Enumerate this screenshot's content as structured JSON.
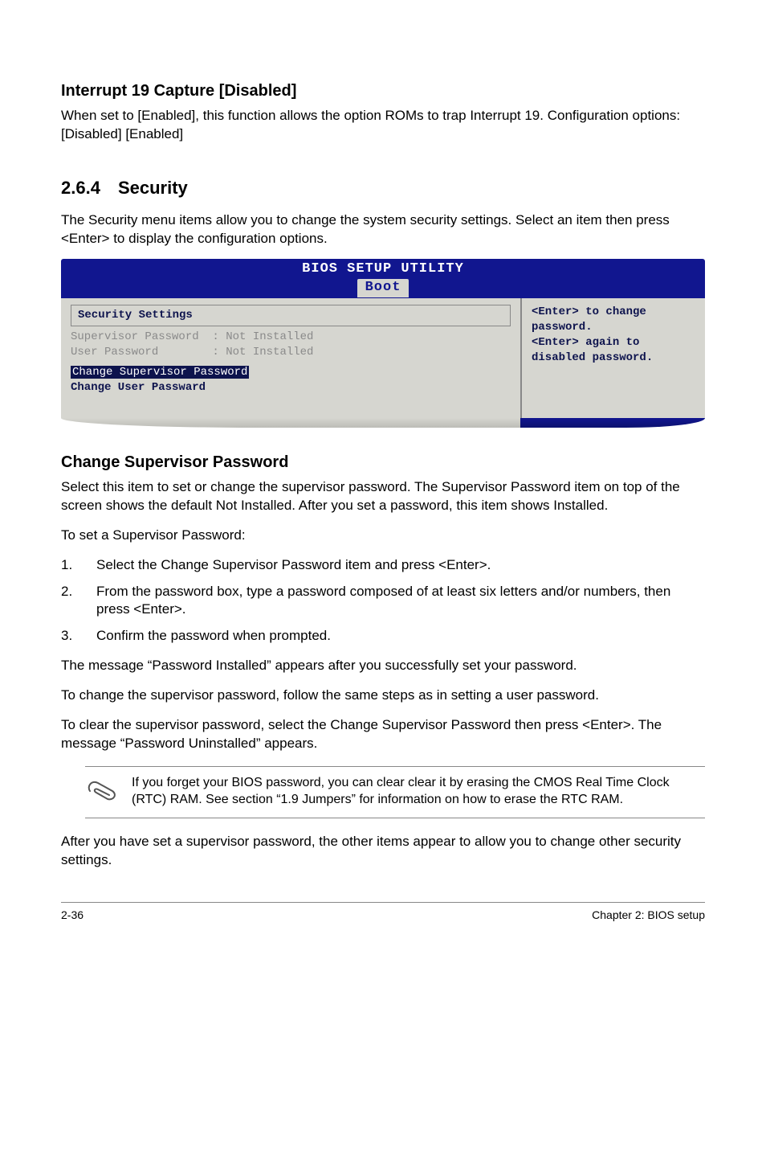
{
  "interrupt": {
    "heading": "Interrupt 19 Capture [Disabled]",
    "body": "When set to [Enabled], this function allows the option ROMs to trap Interrupt 19. Configuration options: [Disabled] [Enabled]"
  },
  "section": {
    "num": "2.6.4",
    "title": "Security",
    "intro": "The Security menu items allow you to change the system security settings. Select an item then press <Enter> to display the configuration options."
  },
  "bios": {
    "title": "BIOS SETUP UTILITY",
    "tab": "Boot",
    "headerBox": "Security Settings",
    "rows": {
      "sup": "Supervisor Password  : Not Installed",
      "user": "User Password        : Not Installed"
    },
    "changeSup": "Change Supervisor Password",
    "changeUser": "Change User Passward",
    "help": {
      "l1": "<Enter> to change",
      "l2": "password.",
      "l3": "<Enter> again to",
      "l4": "disabled password."
    }
  },
  "csp": {
    "heading": "Change Supervisor Password",
    "p1": "Select this item to set or change the supervisor password. The Supervisor Password item on top of the screen shows the default Not Installed. After you set a password, this item shows Installed.",
    "p2": "To set a Supervisor Password:",
    "steps": {
      "s1": "Select the Change Supervisor Password item and press <Enter>.",
      "s2": "From the password box, type a password composed of at least six letters and/or numbers, then press <Enter>.",
      "s3": "Confirm the password when prompted."
    },
    "n1": "1.",
    "n2": "2.",
    "n3": "3.",
    "p3": "The message “Password Installed” appears after you successfully set your password.",
    "p4": "To change the supervisor password, follow the same steps as in setting a user password.",
    "p5": "To clear the supervisor password, select the Change Supervisor Password then press <Enter>. The message “Password Uninstalled” appears."
  },
  "note": {
    "text": "If you forget your BIOS password, you can clear clear it by erasing the CMOS Real Time Clock (RTC) RAM. See section “1.9  Jumpers” for information on how to erase the RTC RAM."
  },
  "after": "After you have set a supervisor password, the other items appear to allow you to change other security settings.",
  "footer": {
    "left": "2-36",
    "right": "Chapter 2: BIOS setup"
  }
}
